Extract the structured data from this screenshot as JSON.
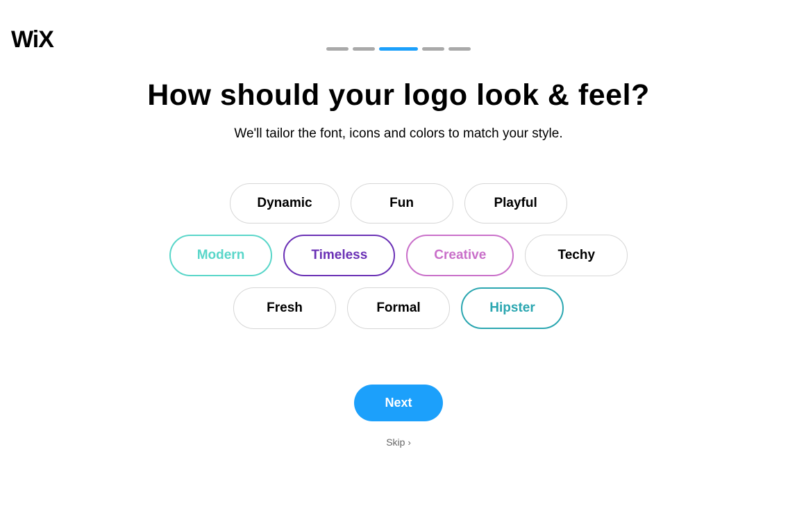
{
  "logo": "WiX",
  "progress": {
    "total": 5,
    "activeIndex": 2
  },
  "heading": "How should your logo look & feel?",
  "subheading": "We'll tailor the font, icons and colors to match your style.",
  "chips": {
    "row1": [
      {
        "label": "Dynamic",
        "variant": "default"
      },
      {
        "label": "Fun",
        "variant": "default"
      },
      {
        "label": "Playful",
        "variant": "default"
      }
    ],
    "row2": [
      {
        "label": "Modern",
        "variant": "teal"
      },
      {
        "label": "Timeless",
        "variant": "purple"
      },
      {
        "label": "Creative",
        "variant": "pink"
      },
      {
        "label": "Techy",
        "variant": "default"
      }
    ],
    "row3": [
      {
        "label": "Fresh",
        "variant": "default"
      },
      {
        "label": "Formal",
        "variant": "default"
      },
      {
        "label": "Hipster",
        "variant": "cyan"
      }
    ]
  },
  "buttons": {
    "next": "Next",
    "skip": "Skip"
  }
}
